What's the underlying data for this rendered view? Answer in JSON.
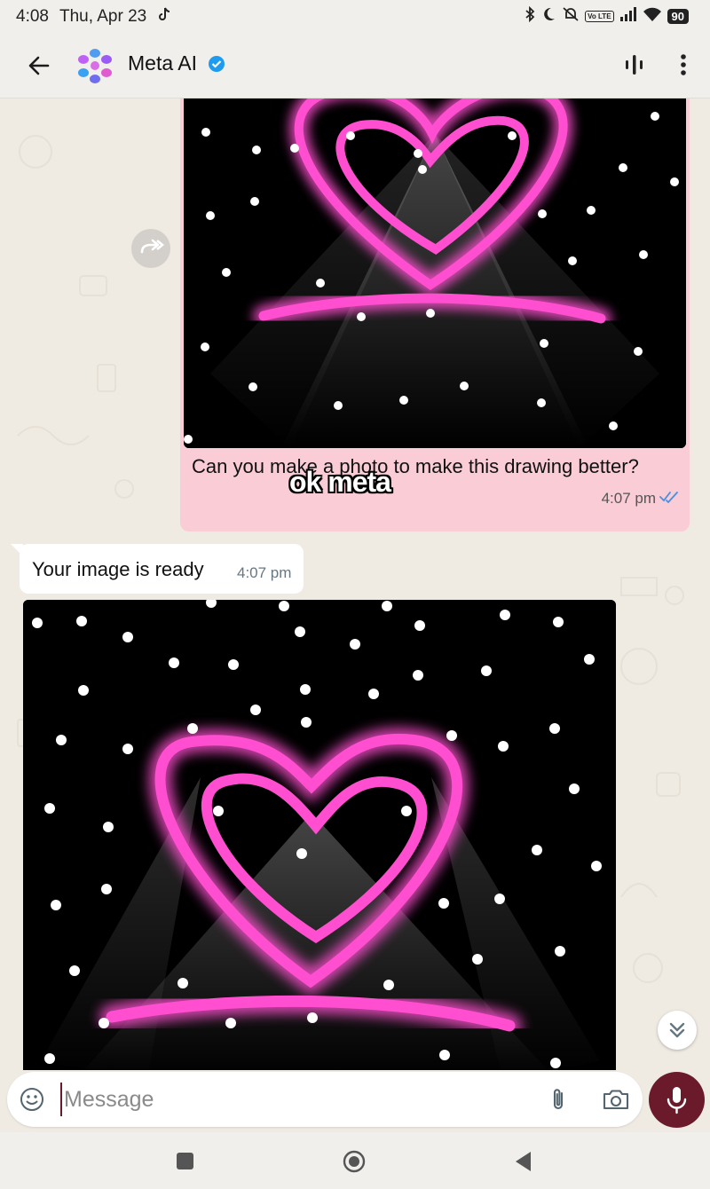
{
  "status_bar": {
    "time": "4:08",
    "date": "Thu, Apr 23",
    "network_badge": "Vo LTE",
    "battery": "90",
    "icons": [
      "tiktok-icon",
      "bluetooth-icon",
      "moon-icon",
      "mute-icon",
      "volte-icon",
      "signal-icon",
      "wifi-icon",
      "battery-icon"
    ]
  },
  "header": {
    "contact_name": "Meta AI",
    "verified": true,
    "icons": [
      "back-arrow-icon",
      "meta-ai-avatar",
      "verified-icon",
      "voice-chat-icon",
      "more-vertical-icon"
    ]
  },
  "messages": {
    "outgoing": {
      "caption": "Can you make a photo to make this drawing better?",
      "time": "4:07 pm",
      "status": "read",
      "image": "neon-heart-drawing"
    },
    "incoming": {
      "text": "Your image is ready",
      "time": "4:07 pm",
      "image": "neon-heart-generated"
    }
  },
  "overlay_caption": "ok meta",
  "composer": {
    "placeholder": "Message"
  },
  "colors": {
    "outgoing_bubble": "#f9ccd6",
    "incoming_bubble": "#ffffff",
    "chat_background": "#efeae2",
    "mic_button": "#6b1a2c",
    "neon_pink": "#ff5fd8",
    "read_ticks": "#4a90e2",
    "verified_badge": "#1d9bf0"
  }
}
